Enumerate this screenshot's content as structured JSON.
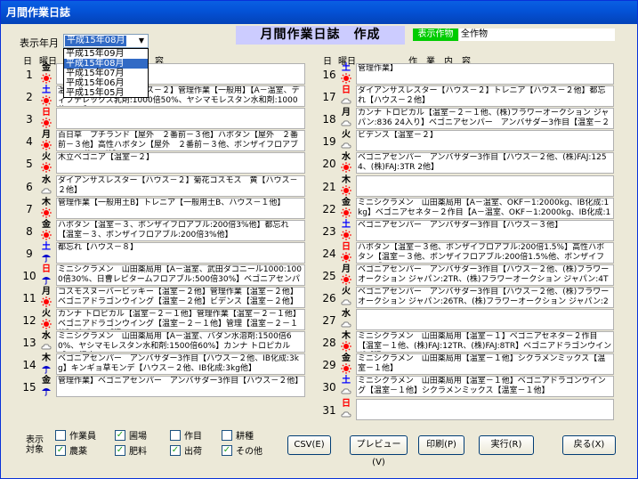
{
  "window": {
    "title": "月間作業日誌"
  },
  "header": {
    "year_month_label": "表示年月",
    "year_month_value": "平成15年08月",
    "year_month_options": [
      "平成15年09月",
      "平成15年08月",
      "平成15年07月",
      "平成15年06月",
      "平成15年05月"
    ],
    "year_month_selected": 1,
    "heading": "月間作業日誌　作成",
    "crop_label": "表示作物",
    "crop_value": "全作物"
  },
  "columns": {
    "day": "日",
    "weekday": "曜日",
    "content": "作　業　内　容",
    "content_left_suffix": "容"
  },
  "colors": {
    "sunny": "#ff0000",
    "cloudy": "#808080",
    "rain": "#0000cc",
    "saturday": "#0000ff",
    "sunday": "#ff0000",
    "heading_bg": "#ccccff",
    "crop_label_bg": "#00cc00"
  },
  "days": [
    {
      "day": "1",
      "weekday": "金",
      "weather": "sunny",
      "entry": ""
    },
    {
      "day": "2",
      "weekday": "土",
      "weather": "sunny",
      "entry": "温室】プチトマト【ハウス－２】管理作業【一般用】【A－温室、ディプテレックス乳剤:1000倍50%、ヤシマモレスタン水和剤:1000倍50%】"
    },
    {
      "day": "3",
      "weekday": "日",
      "weather": "sunny",
      "entry": ""
    },
    {
      "day": "4",
      "weekday": "月",
      "weather": "sunny",
      "entry": "百日草　プチランド【屋外　２番前－３他】ハボタン【屋外　２番前－３他】高性ハボタン【屋外　２番前－３他、ボンザイフロアブル:200倍3%他】"
    },
    {
      "day": "5",
      "weekday": "火",
      "weather": "sunny",
      "entry": "木立ベゴニア【温室－２】"
    },
    {
      "day": "6",
      "weekday": "水",
      "weather": "cloudy",
      "entry": "ダイアンサスレスター【ハウス－２】菊花コスモス　黄【ハウス－２他】"
    },
    {
      "day": "7",
      "weekday": "木",
      "weather": "sunny",
      "entry": "管理作業【一般用土B】トレニア【一般用土B、ハウス－１他】"
    },
    {
      "day": "8",
      "weekday": "金",
      "weather": "sunny",
      "entry": "ハボタン【温室－３、ボンザイフロアブル:200倍3%他】都忘れ【温室－３、ボンザイフロアブル:200倍3%他】"
    },
    {
      "day": "9",
      "weekday": "土",
      "weather": "rain",
      "entry": "都忘れ【ハウス－８】"
    },
    {
      "day": "10",
      "weekday": "日",
      "weather": "rain",
      "entry": "ミニシクラメン　山田薬局用【A－温室、武田ダコニール1000:1000倍30%、日曹レピタームフロアブル:500倍30%】ベゴニアセンパー　ア"
    },
    {
      "day": "11",
      "weekday": "月",
      "weather": "sunny",
      "entry": "コスモスヌーバービッキー【温室－２他】管理作業【温室－２他】ベゴニアドラゴンウイング【温室－２他】ビデンス【温室－２他】"
    },
    {
      "day": "12",
      "weekday": "火",
      "weather": "sunny",
      "entry": "カンナ トロピカル【温室－２－１他】管理作業【温室－２－１他】ベゴニアドラゴンウイング【温室－２－１他】管理【温室－２－１他】ビデンス【温"
    },
    {
      "day": "13",
      "weekday": "水",
      "weather": "cloudy",
      "entry": "ミニシクラメン　山田薬局用【A－温室、バダン水溶剤:1500倍60%、ヤシマモレスタン水和剤:1500倍60%】カンナ トロピカル【A－温室"
    },
    {
      "day": "14",
      "weekday": "木",
      "weather": "rain",
      "entry": "ベゴニアセンパー　アンバサダー3作目【ハウス－２他、IB化成:3kg】キンギョ草モンデ【ハウス－２他、IB化成:3kg他】"
    },
    {
      "day": "15",
      "weekday": "金",
      "weather": "rain",
      "entry": "管理作業】ベゴニアセンパー　アンバサダー3作目【ハウス－２他】"
    },
    {
      "day": "16",
      "weekday": "土",
      "weather": "sunny",
      "entry": "管理作業】"
    },
    {
      "day": "17",
      "weekday": "日",
      "weather": "cloudy",
      "entry": "ダイアンサスレスター【ハウス－２】トレニア【ハウス－２他】都忘れ【ハウス－２他】"
    },
    {
      "day": "18",
      "weekday": "月",
      "weather": "cloudy",
      "entry": "カンナ トロピカル【温室－２－１他、(株)フラワーオークション ジャパン:836 24入り】ベゴニアセンパー　アンバサダー3作目【温室－２－"
    },
    {
      "day": "19",
      "weekday": "火",
      "weather": "cloudy",
      "entry": "ビデンス【温室－２】"
    },
    {
      "day": "20",
      "weekday": "水",
      "weather": "sunny",
      "entry": "ベゴニアセンパー　アンバサダー3作目【ハウス－２他、(株)FAJ:125 4、(株)FAJ:3TR 2他】"
    },
    {
      "day": "21",
      "weekday": "木",
      "weather": "sunny",
      "entry": ""
    },
    {
      "day": "22",
      "weekday": "金",
      "weather": "sunny",
      "entry": "ミニシクラメン　山田薬局用【A－温室、OKF－1:2000kg、IB化成:1kg】ベゴニアセネタ－２作目【A－温室、OKF－1:2000kg、IB化成:1"
    },
    {
      "day": "23",
      "weekday": "土",
      "weather": "sunny",
      "entry": "ベゴニアセンパー　アンバサダー3作目【ハウス－３他】"
    },
    {
      "day": "24",
      "weekday": "日",
      "weather": "sunny",
      "entry": "ハボタン【温室－３他、ボンザイフロアブル:200倍1.5%】高性ハボタン【温室－３他、ボンザイフロアブル:200倍1.5%他、ボンザイフロアブ"
    },
    {
      "day": "25",
      "weekday": "月",
      "weather": "sunny",
      "entry": "ベゴニアセンパー　アンバサダー3作目【ハウス－２他、(株)フラワーオークション ジャパン:2TR、(株)フラワーオークション ジャパン:4TR、"
    },
    {
      "day": "26",
      "weekday": "火",
      "weather": "cloudy",
      "entry": "ベゴニアセンパー　アンバサダー3作目【ハウス－２他、(株)フラワーオークション ジャパン:26TR、(株)フラワーオークション ジャパン:26T"
    },
    {
      "day": "27",
      "weekday": "水",
      "weather": "cloudy",
      "entry": ""
    },
    {
      "day": "28",
      "weekday": "木",
      "weather": "sunny",
      "entry": "ミニシクラメン　山田薬局用【温室－１】ベゴニアセネタ－２作目【温室－１他、(株)FAJ:12TR、(株)FAJ:8TR】ベゴニアドラゴンウイング【温"
    },
    {
      "day": "29",
      "weekday": "金",
      "weather": "sunny",
      "entry": "ミニシクラメン　山田薬局用【温室－１他】シクラメンミックス【温室－１他】"
    },
    {
      "day": "30",
      "weekday": "土",
      "weather": "cloudy",
      "entry": "ミニシクラメン　山田薬局用【温室－１他】ベゴニアドラゴンウイング【温室－１他】シクラメンミックス【温室－１他】"
    },
    {
      "day": "31",
      "weekday": "日",
      "weather": "cloudy",
      "entry": ""
    }
  ],
  "filter": {
    "label": "表示対象",
    "options": [
      {
        "label": "作業員",
        "checked": false
      },
      {
        "label": "圃場",
        "checked": true
      },
      {
        "label": "作目",
        "checked": false
      },
      {
        "label": "耕種",
        "checked": false
      },
      {
        "label": "農薬",
        "checked": true
      },
      {
        "label": "肥料",
        "checked": true
      },
      {
        "label": "出荷",
        "checked": true
      },
      {
        "label": "その他",
        "checked": true
      }
    ]
  },
  "buttons": {
    "csv": "CSV(E)",
    "preview": "プレビュー(V)",
    "print": "印刷(P)",
    "run": "実行(R)",
    "back": "戻る(X)"
  }
}
